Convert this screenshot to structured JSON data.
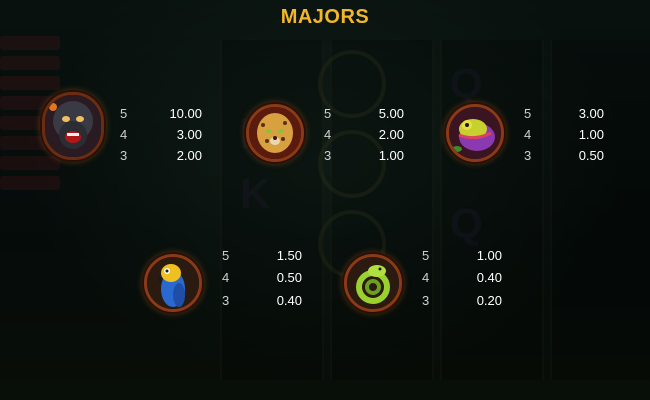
{
  "title": "MAJORS",
  "symbols": [
    {
      "id": "gorilla",
      "icon": "gorilla-icon",
      "pays": [
        {
          "count": "5",
          "value": "10.00"
        },
        {
          "count": "4",
          "value": "3.00"
        },
        {
          "count": "3",
          "value": "2.00"
        }
      ]
    },
    {
      "id": "leopard",
      "icon": "leopard-icon",
      "pays": [
        {
          "count": "5",
          "value": "5.00"
        },
        {
          "count": "4",
          "value": "2.00"
        },
        {
          "count": "3",
          "value": "1.00"
        }
      ]
    },
    {
      "id": "chameleon",
      "icon": "chameleon-icon",
      "pays": [
        {
          "count": "5",
          "value": "3.00"
        },
        {
          "count": "4",
          "value": "1.00"
        },
        {
          "count": "3",
          "value": "0.50"
        }
      ]
    },
    {
      "id": "parrot",
      "icon": "parrot-icon",
      "pays": [
        {
          "count": "5",
          "value": "1.50"
        },
        {
          "count": "4",
          "value": "0.50"
        },
        {
          "count": "3",
          "value": "0.40"
        }
      ]
    },
    {
      "id": "snake",
      "icon": "snake-icon",
      "pays": [
        {
          "count": "5",
          "value": "1.00"
        },
        {
          "count": "4",
          "value": "0.40"
        },
        {
          "count": "3",
          "value": "0.20"
        }
      ]
    }
  ],
  "colors": {
    "title": "#f2b62a",
    "frame": "#8b3a18",
    "text": "#ffffff"
  }
}
